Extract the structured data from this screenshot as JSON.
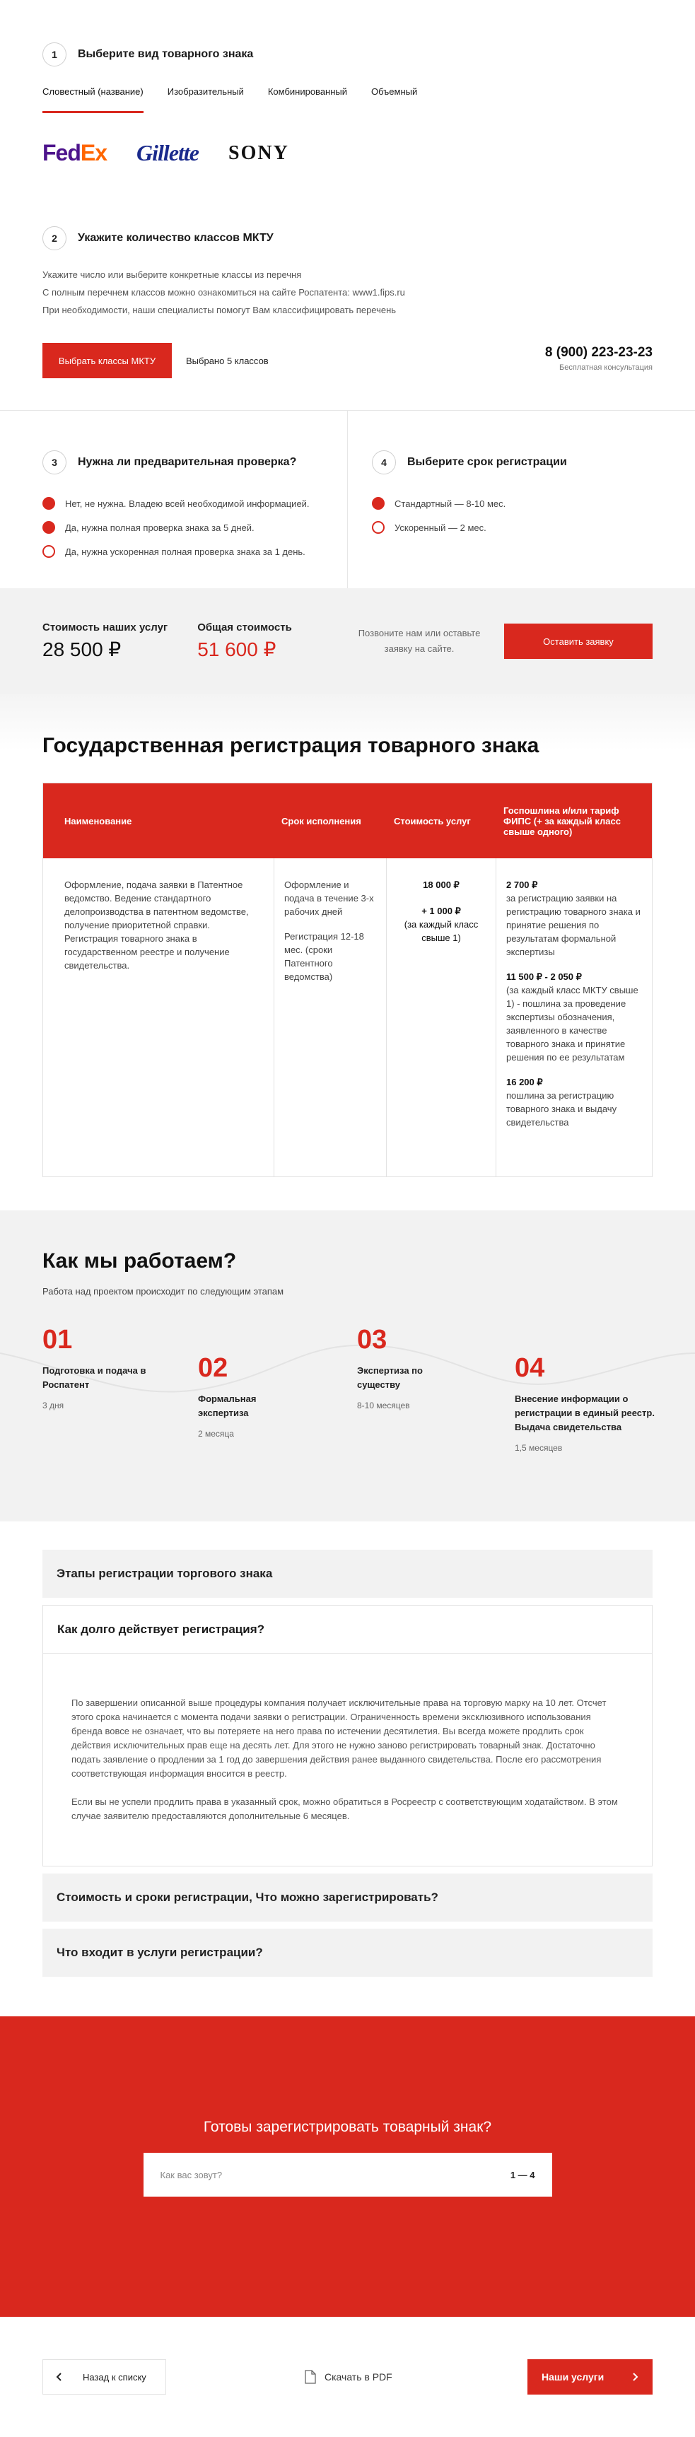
{
  "step1": {
    "num": "1",
    "title": "Выберите вид товарного знака",
    "tabs": [
      "Словестный (название)",
      "Изобразительный",
      "Комбинированный",
      "Объемный"
    ],
    "logos": {
      "fedex_a": "Fed",
      "fedex_b": "Ex",
      "gillette": "Gillette",
      "sony": "SONY"
    }
  },
  "step2": {
    "num": "2",
    "title": "Укажите количество классов МКТУ",
    "lines": [
      "Укажите число или выберите конкретные классы из перечня",
      "С полным перечнем классов можно ознакомиться на сайте Роспатента: www1.fips.ru",
      "При необходимости, наши специалисты помогут Вам классифицировать перечень"
    ],
    "button": "Выбрать классы МКТУ",
    "selected": "Выбрано 5 классов",
    "phone": "8 (900) 223-23-23",
    "phone_sub": "Бесплатная консультация"
  },
  "step3": {
    "num": "3",
    "title": "Нужна ли предварительная проверка?",
    "options": [
      "Нет, не нужна. Владею всей необходимой информацией.",
      "Да, нужна полная проверка знака за 5 дней.",
      "Да, нужна ускоренная полная проверка знака за 1 день."
    ]
  },
  "step4": {
    "num": "4",
    "title": "Выберите срок регистрации",
    "options": [
      "Стандартный — 8-10 мес.",
      "Ускоренный — 2 мес."
    ]
  },
  "cost": {
    "ours_label": "Стоимость наших услуг",
    "ours_value": "28 500 ₽",
    "total_label": "Общая стоимость",
    "total_value": "51 600 ₽",
    "call_text": "Позвоните нам или оставьте заявку на сайте.",
    "order_button": "Оставить заявку"
  },
  "statereg": {
    "title": "Государственная регистрация товарного знака",
    "headers": [
      "Наименование",
      "Срок исполнения",
      "Стоимость услуг",
      "Госпошлина и/или тариф ФИПС (+ за каждый класс свыше одного)"
    ],
    "name": "Оформление, подача заявки в Патентное ведомство. Ведение стандартного делопроизводства в патентном ведомстве, получение приоритетной справки. Регистрация товарного знака в государственном реестре и получение свидетельства.",
    "term1": "Оформление и подача в течение 3-х рабочих дней",
    "term2": "Регистрация 12-18 мес. (сроки Патентного ведомства)",
    "price1": "18 000 ₽",
    "price2": "+ 1 000 ₽",
    "price_note": "(за каждый класс свыше 1)",
    "fees": [
      {
        "num": "2 700 ₽",
        "text": "за регистрацию заявки на регистрацию товарного знака и принятие решения по результатам формальной экспертизы"
      },
      {
        "num": "11 500 ₽ - 2 050 ₽",
        "text": "(за каждый класс МКТУ свыше 1) - пошлина за проведение экспертизы обозначения, заявленного в качестве товарного знака и принятие решения по ее результатам"
      },
      {
        "num": "16 200 ₽",
        "text": "пошлина за регистрацию товарного знака и выдачу свидетельства"
      }
    ]
  },
  "how": {
    "title": "Как мы работаем?",
    "subtitle": "Работа над проектом происходит по следующим этапам",
    "stages": [
      {
        "num": "01",
        "title": "Подготовка и подача в Роспатент",
        "time": "3 дня"
      },
      {
        "num": "02",
        "title": "Формальная экспертиза",
        "time": "2 месяца"
      },
      {
        "num": "03",
        "title": "Экспертиза по существу",
        "time": "8-10 месяцев"
      },
      {
        "num": "04",
        "title": "Внесение информации о регистрации в единый реестр. Выдача свидетельства",
        "time": "1,5 месяцев"
      }
    ]
  },
  "accordion": {
    "item1": "Этапы регистрации торгового знака",
    "open_title": "Как долго действует регистрация?",
    "p1": "По завершении описанной выше процедуры компания получает исключительные права на торговую марку на 10 лет. Отсчет этого срока начинается с момента подачи заявки о регистрации. Ограниченность времени эксклюзивного использования бренда вовсе не означает, что вы потеряете на него права по истечении десятилетия. Вы всегда можете продлить срок действия исключительных прав еще на десять лет. Для этого не нужно заново регистрировать товарный знак. Достаточно подать заявление о продлении за 1 год до завершения действия ранее выданного свидетельства. После его рассмотрения соответствующая информация вносится в реестр.",
    "p2": "Если вы не успели продлить права в указанный срок, можно обратиться в Росреестр с соответствующим ходатайством. В этом случае заявителю предоставляются дополнительные 6 месяцев.",
    "item3": "Стоимость и сроки регистрации, Что можно зарегистрировать?",
    "item4": "Что входит в услуги регистрации?"
  },
  "cta": {
    "title": "Готовы зарегистрировать товарный знак?",
    "placeholder": "Как вас зовут?",
    "step": "1 — 4"
  },
  "footer": {
    "back": "Назад к списку",
    "pdf": "Скачать в PDF",
    "services": "Наши услуги"
  },
  "colors": {
    "accent": "#d9281e"
  }
}
